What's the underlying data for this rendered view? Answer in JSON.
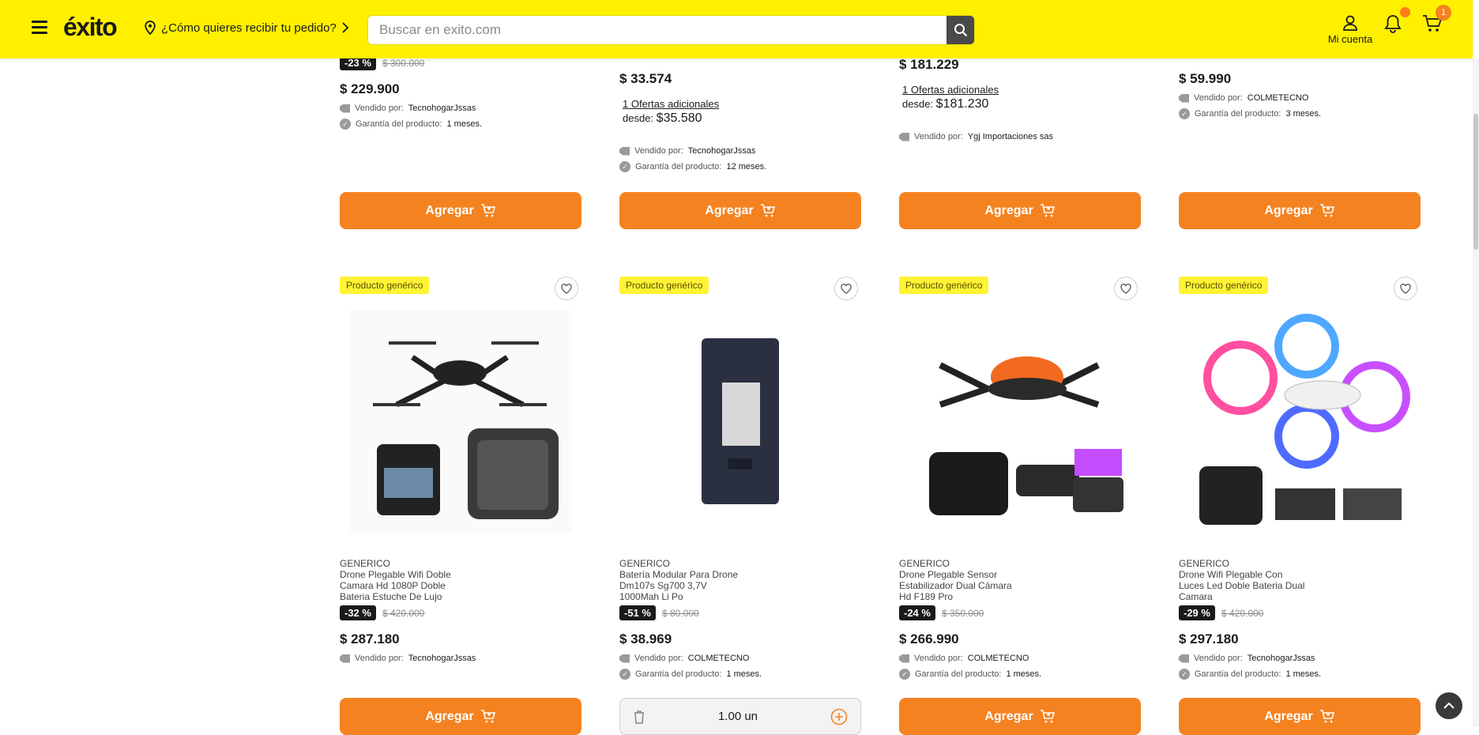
{
  "header": {
    "logo": "éxito",
    "delivery_prompt": "¿Cómo quieres recibir tu pedido?",
    "search_placeholder": "Buscar en exito.com",
    "account_label": "Mi cuenta",
    "cart_count": "1"
  },
  "top_row": [
    {
      "discount": "-23 %",
      "old_price": "$ 300.000",
      "price": "$ 229.900",
      "seller_label": "Vendido por:",
      "seller": "TecnohogarJssas",
      "warranty_label": "Garantía del producto:",
      "warranty": "1 meses.",
      "add_label": "Agregar"
    },
    {
      "price": "$ 33.574",
      "offers": "1 Ofertas adicionales",
      "from_label": "desde:",
      "from_price": "$35.580",
      "seller_label": "Vendido por:",
      "seller": "TecnohogarJssas",
      "warranty_label": "Garantía del producto:",
      "warranty": "12 meses.",
      "add_label": "Agregar"
    },
    {
      "price": "$ 181.229",
      "offers": "1 Ofertas adicionales",
      "from_label": "desde:",
      "from_price": "$181.230",
      "seller_label": "Vendido por:",
      "seller": "Ygj Importaciones sas",
      "add_label": "Agregar"
    },
    {
      "price": "$ 59.990",
      "seller_label": "Vendido por:",
      "seller": "COLMETECNO",
      "warranty_label": "Garantía del producto:",
      "warranty": "3 meses.",
      "add_label": "Agregar"
    }
  ],
  "products": [
    {
      "badge": "Producto genérico",
      "brand": "GENERICO",
      "name": "Drone Plegable Wifi Doble Camara Hd 1080P Doble Bateria Estuche De Lujo",
      "discount": "-32 %",
      "old_price": "$ 420.000",
      "price": "$ 287.180",
      "seller_label": "Vendido por:",
      "seller": "TecnohogarJssas",
      "add_label": "Agregar"
    },
    {
      "badge": "Producto genérico",
      "brand": "GENERICO",
      "name": "Batería Modular Para Drone Dm107s Sg700 3,7V 1000Mah Li Po",
      "discount": "-51 %",
      "old_price": "$ 80.000",
      "price": "$ 38.969",
      "seller_label": "Vendido por:",
      "seller": "COLMETECNO",
      "warranty_label": "Garantía del producto:",
      "warranty": "1 meses.",
      "quantity": "1.00 un"
    },
    {
      "badge": "Producto genérico",
      "brand": "GENERICO",
      "name": "Drone Plegable Sensor Estabilizador Dual Cámara Hd F189 Pro",
      "discount": "-24 %",
      "old_price": "$ 350.000",
      "price": "$ 266.990",
      "seller_label": "Vendido por:",
      "seller": "COLMETECNO",
      "warranty_label": "Garantía del producto:",
      "warranty": "1 meses.",
      "add_label": "Agregar"
    },
    {
      "badge": "Producto genérico",
      "brand": "GENERICO",
      "name": "Drone Wifi Plegable Con Luces Led Doble Bateria Dual Camara",
      "discount": "-29 %",
      "old_price": "$ 420.000",
      "price": "$ 297.180",
      "seller_label": "Vendido por:",
      "seller": "TecnohogarJssas",
      "warranty_label": "Garantía del producto:",
      "warranty": "1 meses.",
      "add_label": "Agregar"
    }
  ],
  "colors": {
    "brand_yellow": "#fff000",
    "cta_orange": "#f58220",
    "badge_yellow": "#fff334"
  }
}
